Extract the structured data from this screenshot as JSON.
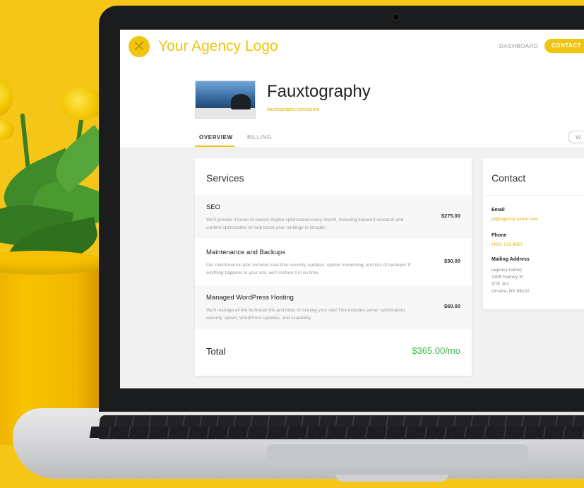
{
  "header": {
    "logo_text": "Your Agency Logo",
    "nav_dashboard": "DASHBOARD",
    "nav_contact": "CONTACT"
  },
  "site": {
    "name": "Fauxtography",
    "url": "fauxtography.com/acme"
  },
  "tabs": [
    {
      "label": "OVERVIEW",
      "active": true
    },
    {
      "label": "BILLING",
      "active": false
    }
  ],
  "pill_button_label": "W",
  "services": {
    "title": "Services",
    "items": [
      {
        "name": "SEO",
        "description": "We'll provide 4 hours of search engine optimization every month, including keyword research and content optimization to help boost your rankings in Google!",
        "price": "$275.00"
      },
      {
        "name": "Maintenance and Backups",
        "description": "Our maintenance plan includes real-time security, updates, uptime monitoring, and lots of backups! If anything happens to your site, we'll restore it in no time.",
        "price": "$30.00"
      },
      {
        "name": "Managed WordPress Hosting",
        "description": "We'll manage all the technical bits and bobs of running your site! This includes server optimization, security, speed, WordPress updates, and scalability.",
        "price": "$60.00"
      }
    ],
    "total_label": "Total",
    "total_value": "$365.00/mo"
  },
  "contact": {
    "title": "Contact",
    "email_label": "Email",
    "email_value": "jill@agency-name.com",
    "phone_label": "Phone",
    "phone_value": "(402) 123-4567",
    "address_label": "Mailing Address",
    "address_lines": [
      "[agency name]",
      "1405 Harney St",
      "STE 301",
      "Omaha, NE 68102"
    ]
  },
  "colors": {
    "accent": "#f1c40f",
    "total": "#3cb54a",
    "background": "#f5c518"
  }
}
